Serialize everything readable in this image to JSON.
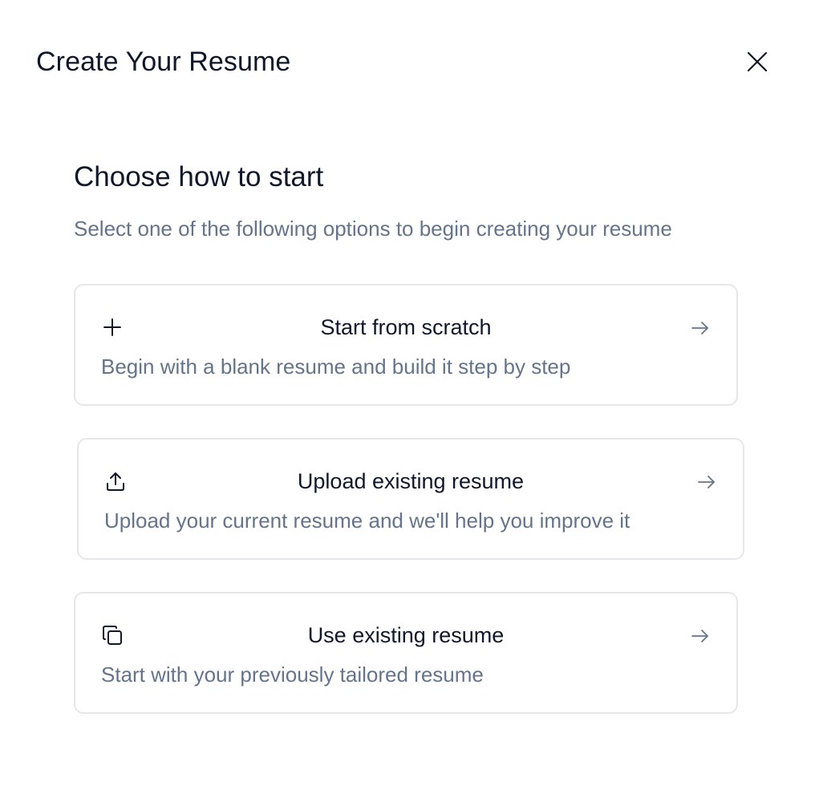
{
  "dialog": {
    "title": "Create Your Resume",
    "close_icon": "close-icon"
  },
  "section": {
    "heading": "Choose how to start",
    "subheading": "Select one of the following options to begin creating your resume"
  },
  "options": [
    {
      "icon": "plus-icon",
      "title": "Start from scratch",
      "description": "Begin with a blank resume and build it step by step",
      "arrow_icon": "arrow-right-icon"
    },
    {
      "icon": "upload-icon",
      "title": "Upload existing resume",
      "description": "Upload your current resume and we'll help you improve it",
      "arrow_icon": "arrow-right-icon"
    },
    {
      "icon": "copy-icon",
      "title": "Use existing resume",
      "description": "Start with your previously tailored resume",
      "arrow_icon": "arrow-right-icon"
    }
  ],
  "colors": {
    "title_text": "#0f172a",
    "muted_text": "#64748b",
    "card_border": "#e5e7eb",
    "background": "#ffffff"
  }
}
